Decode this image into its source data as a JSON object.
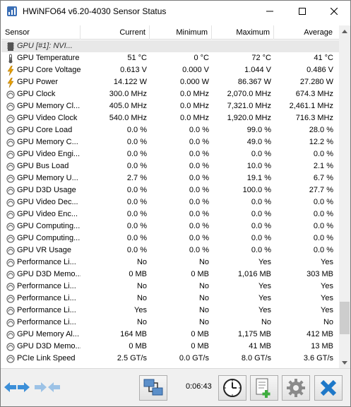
{
  "window": {
    "title": "HWiNFO64 v6.20-4030 Sensor Status"
  },
  "columns": {
    "sensor": "Sensor",
    "current": "Current",
    "minimum": "Minimum",
    "maximum": "Maximum",
    "average": "Average"
  },
  "rows": [
    {
      "icon": "chip-icon",
      "name": "GPU [#1]: NVI...",
      "current": "",
      "min": "",
      "max": "",
      "avg": "",
      "group": true
    },
    {
      "icon": "thermometer-icon",
      "name": "GPU Temperature",
      "current": "51 °C",
      "min": "0 °C",
      "max": "72 °C",
      "avg": "41 °C"
    },
    {
      "icon": "lightning-icon",
      "name": "GPU Core Voltage",
      "current": "0.613 V",
      "min": "0.000 V",
      "max": "1.044 V",
      "avg": "0.486 V"
    },
    {
      "icon": "lightning-icon",
      "name": "GPU Power",
      "current": "14.122 W",
      "min": "0.000 W",
      "max": "86.367 W",
      "avg": "27.280 W"
    },
    {
      "icon": "gauge-icon",
      "name": "GPU Clock",
      "current": "300.0 MHz",
      "min": "0.0 MHz",
      "max": "2,070.0 MHz",
      "avg": "674.3 MHz"
    },
    {
      "icon": "gauge-icon",
      "name": "GPU Memory Cl...",
      "current": "405.0 MHz",
      "min": "0.0 MHz",
      "max": "7,321.0 MHz",
      "avg": "2,461.1 MHz"
    },
    {
      "icon": "gauge-icon",
      "name": "GPU Video Clock",
      "current": "540.0 MHz",
      "min": "0.0 MHz",
      "max": "1,920.0 MHz",
      "avg": "716.3 MHz"
    },
    {
      "icon": "gauge-icon",
      "name": "GPU Core Load",
      "current": "0.0 %",
      "min": "0.0 %",
      "max": "99.0 %",
      "avg": "28.0 %"
    },
    {
      "icon": "gauge-icon",
      "name": "GPU Memory C...",
      "current": "0.0 %",
      "min": "0.0 %",
      "max": "49.0 %",
      "avg": "12.2 %"
    },
    {
      "icon": "gauge-icon",
      "name": "GPU Video Engi...",
      "current": "0.0 %",
      "min": "0.0 %",
      "max": "0.0 %",
      "avg": "0.0 %"
    },
    {
      "icon": "gauge-icon",
      "name": "GPU Bus Load",
      "current": "0.0 %",
      "min": "0.0 %",
      "max": "10.0 %",
      "avg": "2.1 %"
    },
    {
      "icon": "gauge-icon",
      "name": "GPU Memory U...",
      "current": "2.7 %",
      "min": "0.0 %",
      "max": "19.1 %",
      "avg": "6.7 %"
    },
    {
      "icon": "gauge-icon",
      "name": "GPU D3D Usage",
      "current": "0.0 %",
      "min": "0.0 %",
      "max": "100.0 %",
      "avg": "27.7 %"
    },
    {
      "icon": "gauge-icon",
      "name": "GPU Video Dec...",
      "current": "0.0 %",
      "min": "0.0 %",
      "max": "0.0 %",
      "avg": "0.0 %"
    },
    {
      "icon": "gauge-icon",
      "name": "GPU Video Enc...",
      "current": "0.0 %",
      "min": "0.0 %",
      "max": "0.0 %",
      "avg": "0.0 %"
    },
    {
      "icon": "gauge-icon",
      "name": "GPU Computing...",
      "current": "0.0 %",
      "min": "0.0 %",
      "max": "0.0 %",
      "avg": "0.0 %"
    },
    {
      "icon": "gauge-icon",
      "name": "GPU Computing...",
      "current": "0.0 %",
      "min": "0.0 %",
      "max": "0.0 %",
      "avg": "0.0 %"
    },
    {
      "icon": "gauge-icon",
      "name": "GPU VR Usage",
      "current": "0.0 %",
      "min": "0.0 %",
      "max": "0.0 %",
      "avg": "0.0 %"
    },
    {
      "icon": "gauge-icon",
      "name": "Performance Li...",
      "current": "No",
      "min": "No",
      "max": "Yes",
      "avg": "Yes"
    },
    {
      "icon": "gauge-icon",
      "name": "GPU D3D Memo...",
      "current": "0 MB",
      "min": "0 MB",
      "max": "1,016 MB",
      "avg": "303 MB"
    },
    {
      "icon": "gauge-icon",
      "name": "Performance Li...",
      "current": "No",
      "min": "No",
      "max": "Yes",
      "avg": "Yes"
    },
    {
      "icon": "gauge-icon",
      "name": "Performance Li...",
      "current": "No",
      "min": "No",
      "max": "Yes",
      "avg": "Yes"
    },
    {
      "icon": "gauge-icon",
      "name": "Performance Li...",
      "current": "Yes",
      "min": "No",
      "max": "Yes",
      "avg": "Yes"
    },
    {
      "icon": "gauge-icon",
      "name": "Performance Li...",
      "current": "No",
      "min": "No",
      "max": "No",
      "avg": "No"
    },
    {
      "icon": "gauge-icon",
      "name": "GPU Memory Al...",
      "current": "164 MB",
      "min": "0 MB",
      "max": "1,175 MB",
      "avg": "412 MB"
    },
    {
      "icon": "gauge-icon",
      "name": "GPU D3D Memo...",
      "current": "0 MB",
      "min": "0 MB",
      "max": "41 MB",
      "avg": "13 MB"
    },
    {
      "icon": "gauge-icon",
      "name": "PCIe Link Speed",
      "current": "2.5 GT/s",
      "min": "0.0 GT/s",
      "max": "8.0 GT/s",
      "avg": "3.6 GT/s"
    }
  ],
  "toolbar": {
    "elapsed_time": "0:06:43"
  },
  "colors": {
    "accent_blue": "#3c8fd8",
    "close_blue": "#1e78c8",
    "icon_gray": "#555555",
    "lightning": "#e8a000"
  }
}
